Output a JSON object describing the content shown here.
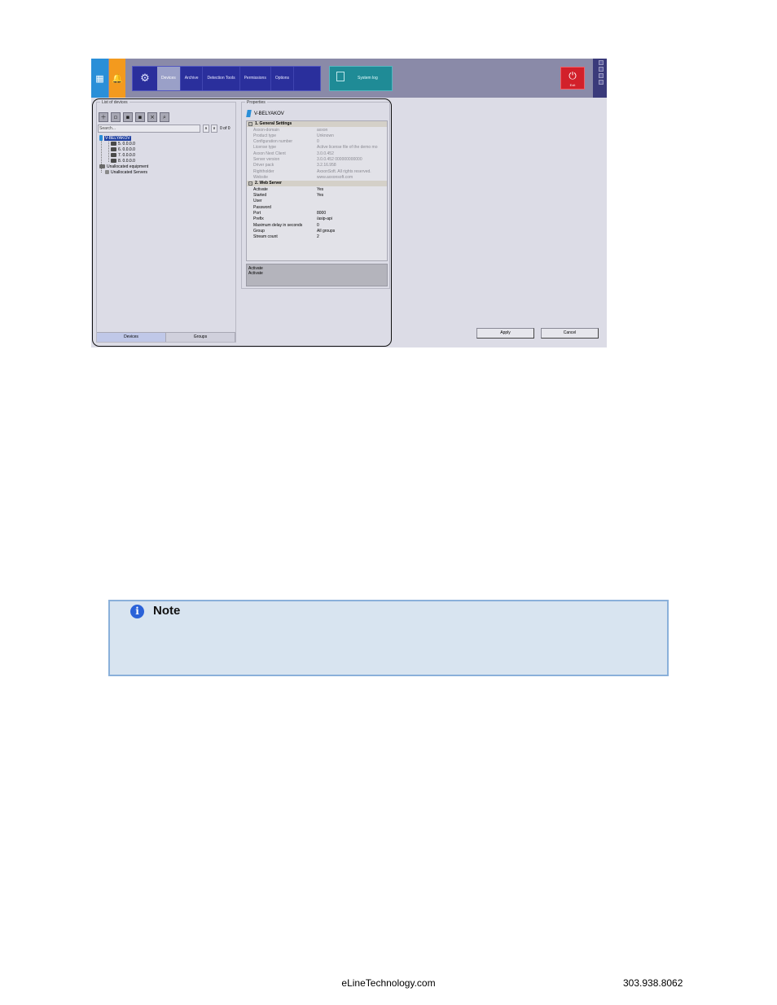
{
  "screenshot": {
    "menu_tabs": [
      "Devices",
      "Archive",
      "Detection Tools",
      "Permissions",
      "Options"
    ],
    "active_tab": "Devices",
    "system_log_label": "System log",
    "exit_label": "Exit",
    "devices_panel": {
      "caption": "List of devices",
      "search_placeholder": "Search...",
      "count": "0 of 0",
      "tree": {
        "root": "V-BELYAKOV",
        "cameras": [
          "5. 0.0.0.0",
          "6. 0.0.0.0",
          "7. 0.0.0.0",
          "8. 0.0.0.0"
        ],
        "unallocated_equipment": "Unallocated equipment",
        "unallocated_servers": "Unallocated Servers"
      },
      "tabs": [
        "Devices",
        "Groups"
      ]
    },
    "properties_panel": {
      "caption": "Properties",
      "header": "V-BELYAKOV",
      "sections": [
        {
          "title": "1. General Settings",
          "rows": [
            {
              "key": "Axxon-domain",
              "value": "axxon"
            },
            {
              "key": "Product type",
              "value": "Unknown"
            },
            {
              "key": "Configuration number",
              "value": "0"
            },
            {
              "key": "License type",
              "value": "Active license file of the demo mo"
            },
            {
              "key": "Axxon Next Client",
              "value": "3.0.0.452"
            },
            {
              "key": "Server version",
              "value": "3.0.0.452 000000000000"
            },
            {
              "key": "Driver pack",
              "value": "3.2.16.958"
            },
            {
              "key": "Rightholder",
              "value": "AxxonSoft. All rights reserved."
            },
            {
              "key": "Website",
              "value": "www.axxonsoft.com"
            }
          ]
        },
        {
          "title": "2. Web Server",
          "rows": [
            {
              "key": "Activate",
              "value": "Yes"
            },
            {
              "key": "Started",
              "value": "Yes"
            },
            {
              "key": "User",
              "value": ""
            },
            {
              "key": "Password",
              "value": ""
            },
            {
              "key": "Port",
              "value": "8000"
            },
            {
              "key": "Prefix",
              "value": "/asip-api"
            },
            {
              "key": "Maximum delay in seconds",
              "value": "0"
            },
            {
              "key": "Group",
              "value": "All groups"
            },
            {
              "key": "Stream count",
              "value": "2"
            }
          ]
        }
      ],
      "description_title": "Activate",
      "description_text": "Activate"
    },
    "apply_label": "Apply",
    "cancel_label": "Cancel"
  },
  "note": {
    "title": "Note"
  },
  "footer": {
    "website": "eLineTechnology.com",
    "phone": "303.938.8062"
  }
}
